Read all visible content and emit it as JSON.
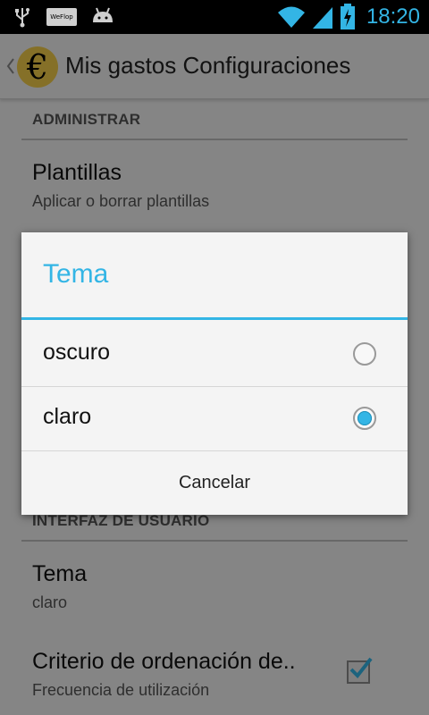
{
  "status_bar": {
    "time": "18:20",
    "icons": [
      "usb-icon",
      "wu-icon",
      "android-icon",
      "wifi-icon",
      "signal-icon",
      "battery-charging-icon"
    ],
    "wu_label": "WeFlop",
    "accent_color": "#33b5e5"
  },
  "action_bar": {
    "app_icon_glyph": "€",
    "title": "Mis gastos Configuraciones"
  },
  "preferences": {
    "section_admin": "ADMINISTRAR",
    "plantillas_title": "Plantillas",
    "plantillas_summary": "Aplicar o borrar plantillas",
    "section_ui": "INTERFAZ DE USUARIO",
    "tema_title": "Tema",
    "tema_summary": "claro",
    "orden_title": "Criterio de ordenación de..",
    "orden_summary": "Frecuencia de utilización",
    "orden_checked": true
  },
  "dialog": {
    "title": "Tema",
    "options": [
      {
        "label": "oscuro",
        "selected": false
      },
      {
        "label": "claro",
        "selected": true
      }
    ],
    "cancel_label": "Cancelar"
  }
}
